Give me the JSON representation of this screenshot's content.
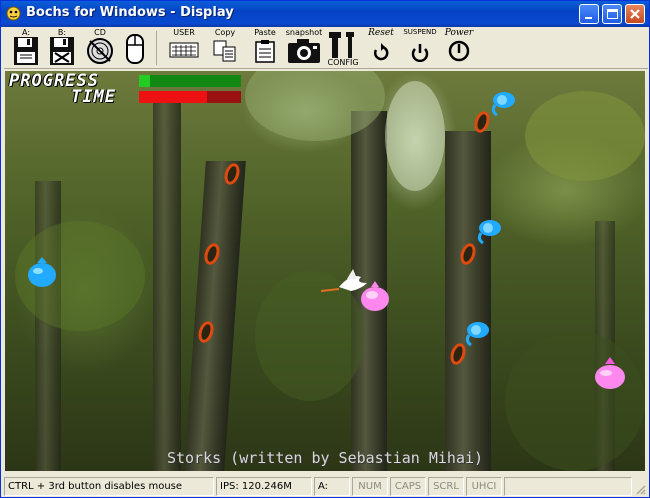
{
  "window": {
    "title": "Bochs for Windows - Display"
  },
  "toolbar": {
    "floppy_a": "A:",
    "floppy_b": "B:",
    "cdrom": "CD",
    "user": "USER",
    "copy": "Copy",
    "paste": "Paste",
    "snapshot": "snapshot",
    "config": "CONFIG",
    "reset": "Reset",
    "suspend": "SUSPEND",
    "power": "Power"
  },
  "game": {
    "progress_label": "PROGRESS",
    "time_label": "TIME",
    "progress_fraction": 0.11,
    "time_fraction": 0.67,
    "credit": "Storks (written by Sebastian Mihai)",
    "colors": {
      "progress_fill": "#22cc22",
      "progress_track": "#118811",
      "time_fill": "#ee1111",
      "time_track": "#991111",
      "cyan_baby": "#22aaff",
      "pink_baby": "#ff88ee",
      "hole": "#e04a10"
    }
  },
  "status": {
    "hint": "CTRL + 3rd button disables mouse",
    "ips": "IPS: 120.246M",
    "drive": "A:",
    "num": "NUM",
    "caps": "CAPS",
    "scrl": "SCRL",
    "uhci": "UHCI"
  }
}
